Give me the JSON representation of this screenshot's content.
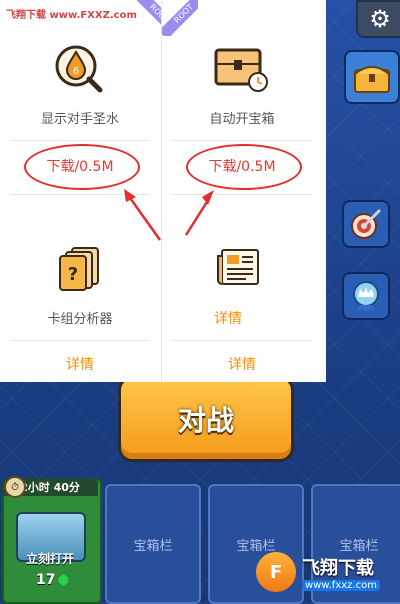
{
  "watermark": {
    "site": "飞翔下载 www.FXXZ.com"
  },
  "ribbon": {
    "label": "ROOT"
  },
  "cards": [
    {
      "title": "显示对手圣水",
      "action": "下载/0.5M",
      "icon": "elixir-search-icon"
    },
    {
      "title": "自动开宝箱",
      "action": "下载/0.5M",
      "icon": "treasure-chest-timer-icon"
    },
    {
      "title": "卡组分析器",
      "action": "详情",
      "icon": "card-deck-question-icon"
    },
    {
      "title": "详情",
      "action": "详情",
      "icon": "newspaper-icon"
    }
  ],
  "game": {
    "battle_label": "对战",
    "timer": "2小时 40分",
    "unlock_label": "立刻打开",
    "gem_cost": "17",
    "slot_label": "宝箱栏"
  },
  "logo": {
    "name": "飞翔下载",
    "url": "www.fxxz.com"
  },
  "colors": {
    "accent": "#ff8a00",
    "highlight": "#e52d2d",
    "battle": "#f5a623"
  }
}
